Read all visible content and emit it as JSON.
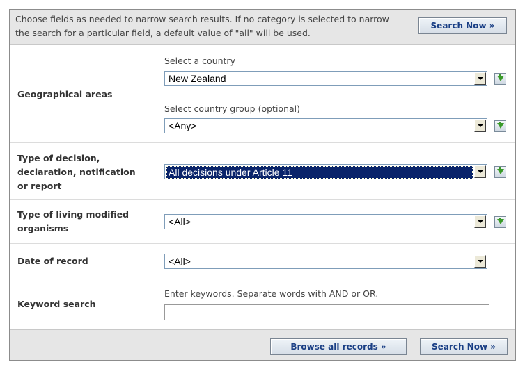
{
  "intro_text": "Choose fields as needed to narrow search results. If no category is selected to narrow the search for a particular field, a default value of \"all\" will be used.",
  "buttons": {
    "search_now_top": "Search Now »",
    "browse_all": "Browse all records »",
    "search_now_bottom": "Search Now »"
  },
  "geo": {
    "label": "Geographical areas",
    "country_hint": "Select a country",
    "country_value": "New Zealand",
    "group_hint": "Select country group (optional)",
    "group_value": "<Any>"
  },
  "decision": {
    "label_lines": [
      "Type of decision,",
      "declaration, notification",
      "or report"
    ],
    "value": "All decisions under Article 11"
  },
  "lmo": {
    "label_lines": [
      "Type of living modified",
      "organisms"
    ],
    "value": "<All>"
  },
  "date": {
    "label": "Date of record",
    "value": "<All>"
  },
  "keyword": {
    "label": "Keyword search",
    "hint": "Enter keywords. Separate words with AND or OR.",
    "value": ""
  },
  "icons": {
    "add": "add-to-list-icon",
    "dropdown": "chevron-down-icon"
  }
}
